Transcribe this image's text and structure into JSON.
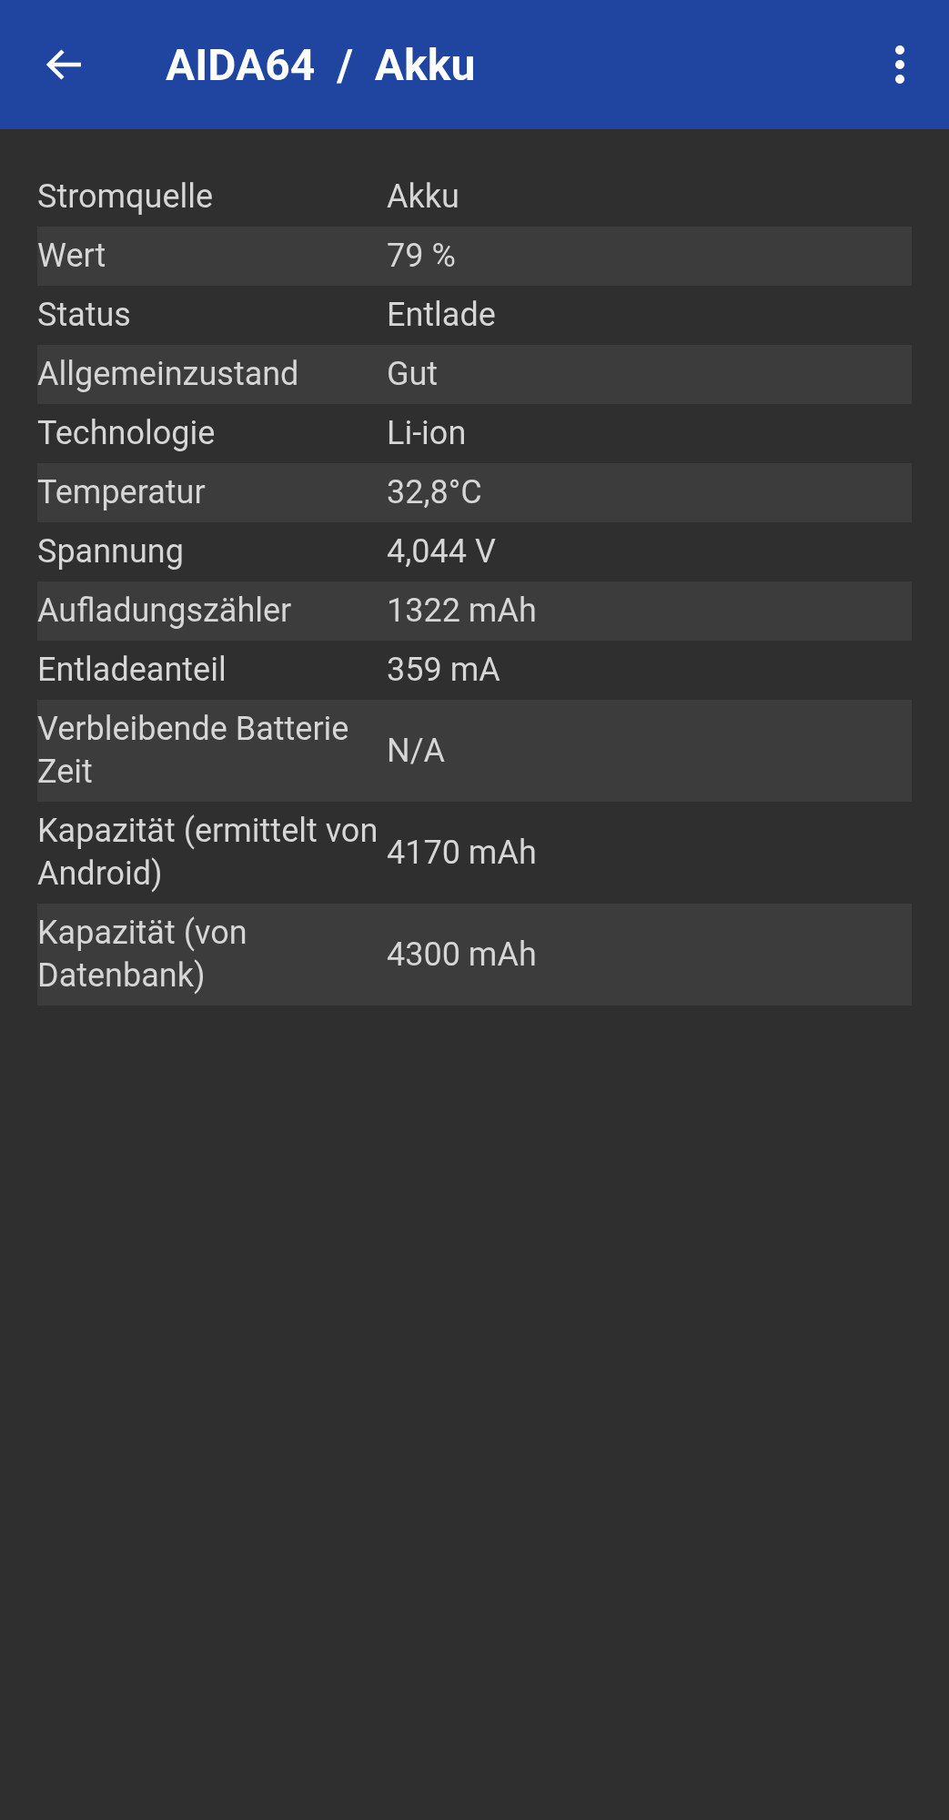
{
  "app_bar": {
    "title": "AIDA64  /  Akku"
  },
  "rows": [
    {
      "label": "Stromquelle",
      "value": "Akku"
    },
    {
      "label": "Wert",
      "value": "79 %"
    },
    {
      "label": "Status",
      "value": "Entlade"
    },
    {
      "label": "Allgemeinzustand",
      "value": "Gut"
    },
    {
      "label": "Technologie",
      "value": "Li-ion"
    },
    {
      "label": "Temperatur",
      "value": "32,8°C"
    },
    {
      "label": "Spannung",
      "value": "4,044 V"
    },
    {
      "label": "Aufladungszähler",
      "value": "1322 mAh"
    },
    {
      "label": "Entladeanteil",
      "value": "359 mA"
    },
    {
      "label": "Verbleibende Batterie Zeit",
      "value": "N/A"
    },
    {
      "label": "Kapazität (ermittelt von Android)",
      "value": "4170 mAh"
    },
    {
      "label": "Kapazität (von Datenbank)",
      "value": "4300 mAh"
    }
  ]
}
